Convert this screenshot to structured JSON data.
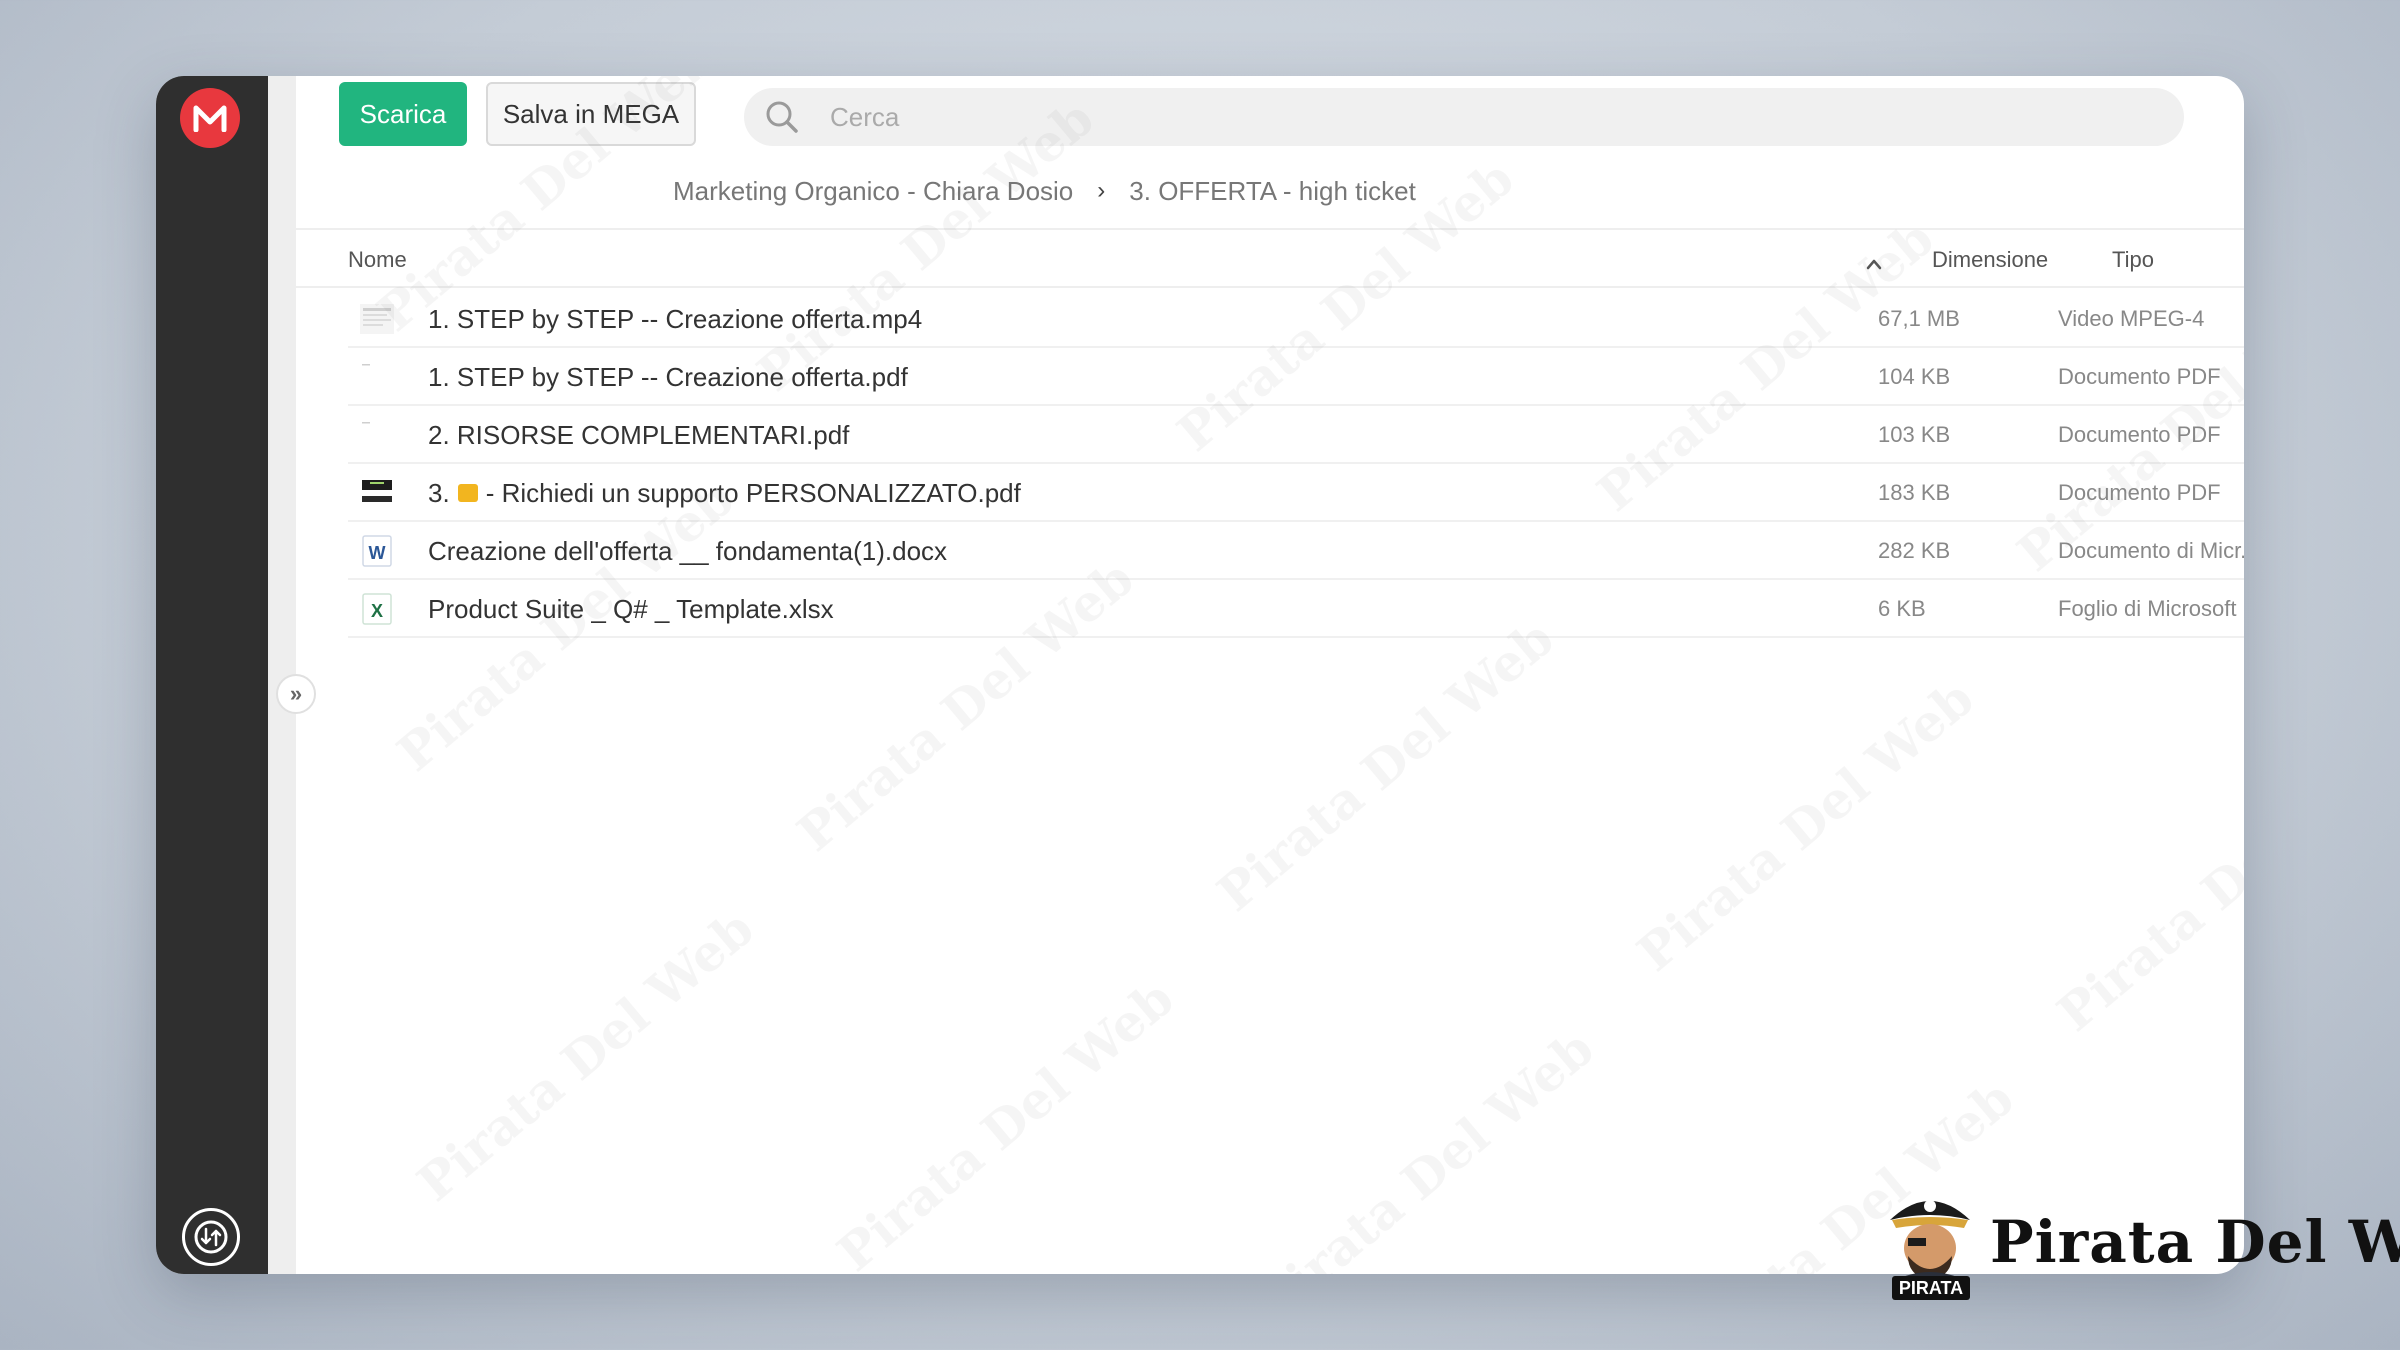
{
  "toolbar": {
    "download_label": "Scarica",
    "save_label": "Salva in MEGA",
    "search_placeholder": "Cerca"
  },
  "breadcrumb": {
    "items": [
      "Marketing Organico - Chiara Dosio",
      "3. OFFERTA - high ticket"
    ],
    "separator": "›"
  },
  "table": {
    "columns": {
      "name": "Nome",
      "size": "Dimensione",
      "type": "Tipo"
    },
    "sort_indicator": "^",
    "rows": [
      {
        "name": "1. STEP by STEP -- Creazione offerta.mp4",
        "size": "67,1 MB",
        "type": "Video MPEG-4",
        "icon": "video-thumbnail-icon"
      },
      {
        "name": "1. STEP by STEP -- Creazione offerta.pdf",
        "size": "104 KB",
        "type": "Documento PDF",
        "icon": "pdf-thumbnail-icon"
      },
      {
        "name": "2. RISORSE COMPLEMENTARI.pdf",
        "size": "103 KB",
        "type": "Documento PDF",
        "icon": "pdf-thumbnail-icon"
      },
      {
        "name_prefix": "3.",
        "name_suffix": "- Richiedi un supporto PERSONALIZZATO.pdf",
        "size": "183 KB",
        "type": "Documento PDF",
        "icon": "pdf-thumbnail-icon"
      },
      {
        "name": "Creazione dell'offerta __ fondamenta(1).docx",
        "size": "282 KB",
        "type": "Documento di Micr...",
        "icon": "word-doc-icon"
      },
      {
        "name": "Product Suite _ Q# _ Template.xlsx",
        "size": "6 KB",
        "type": "Foglio di Microsoft ...",
        "icon": "excel-sheet-icon"
      }
    ]
  },
  "watermark": {
    "text": "Pirata Del Web"
  },
  "brand": {
    "name": "Pirata Del Web",
    "badge_label": "PIRATA"
  },
  "colors": {
    "accent_green": "#21b57f",
    "mega_red": "#e8383e",
    "sidebar": "#2f2f2f"
  },
  "icons": {
    "logo": "mega-logo-icon",
    "transfer": "transfer-manager-icon",
    "expand": "chevrons-right-icon",
    "search": "search-icon"
  }
}
